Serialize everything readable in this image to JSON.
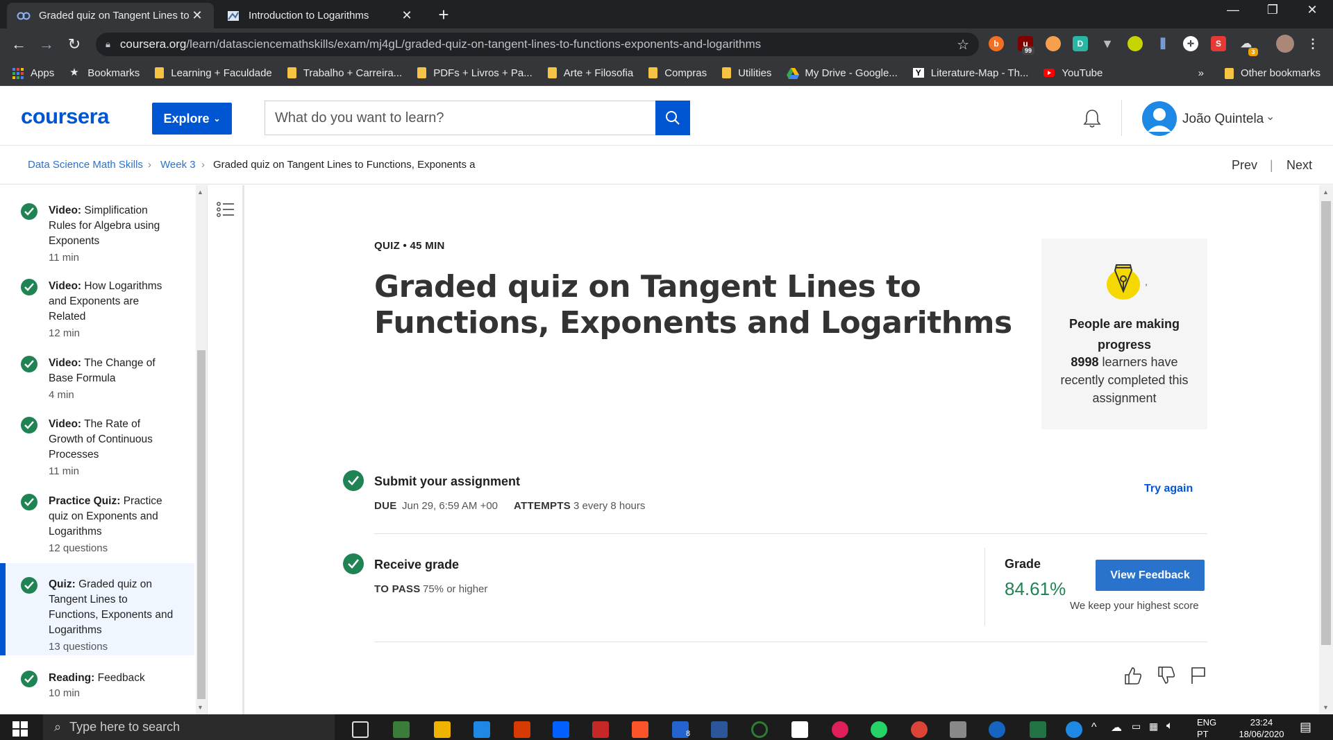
{
  "browser": {
    "tabs": [
      {
        "title": "Graded quiz on Tangent Lines to",
        "active": true
      },
      {
        "title": "Introduction to Logarithms",
        "active": false
      }
    ],
    "url_host": "coursera.org",
    "url_path": "/learn/datasciencemathskills/exam/mj4gL/graded-quiz-on-tangent-lines-to-functions-exponents-and-logarithms",
    "extension_badges": {
      "ublock": "99",
      "other": "3"
    },
    "bookmarks": [
      {
        "label": "Apps",
        "icon": "apps-grid-icon"
      },
      {
        "label": "Bookmarks",
        "icon": "star-icon"
      },
      {
        "label": "Learning + Faculdade",
        "icon": "folder-icon"
      },
      {
        "label": "Trabalho + Carreira...",
        "icon": "folder-icon"
      },
      {
        "label": "PDFs + Livros + Pa...",
        "icon": "folder-icon"
      },
      {
        "label": "Arte + Filosofia",
        "icon": "folder-icon"
      },
      {
        "label": "Compras",
        "icon": "folder-icon"
      },
      {
        "label": "Utilities",
        "icon": "folder-icon"
      },
      {
        "label": "My Drive - Google...",
        "icon": "google-drive-icon"
      },
      {
        "label": "Literature-Map - Th...",
        "icon": "literature-map-icon"
      },
      {
        "label": "YouTube",
        "icon": "youtube-icon"
      }
    ],
    "bookmarks_overflow": "»",
    "other_bookmarks": "Other bookmarks"
  },
  "header": {
    "logo": "coursera",
    "explore_label": "Explore",
    "search_placeholder": "What do you want to learn?",
    "user_name": "João Quintela"
  },
  "breadcrumb": {
    "course": "Data Science Math Skills",
    "week": "Week 3",
    "current": "Graded quiz on Tangent Lines to Functions, Exponents a",
    "prev": "Prev",
    "next": "Next",
    "sep": "|"
  },
  "sidebar": {
    "items": [
      {
        "kind": "Video:",
        "title": "Simplification Rules for Algebra using Exponents",
        "meta": "11 min",
        "completed": true,
        "active": false
      },
      {
        "kind": "Video:",
        "title": "How Logarithms and Exponents are Related",
        "meta": "12 min",
        "completed": true,
        "active": false
      },
      {
        "kind": "Video:",
        "title": "The Change of Base Formula",
        "meta": "4 min",
        "completed": true,
        "active": false
      },
      {
        "kind": "Video:",
        "title": "The Rate of Growth of Continuous Processes",
        "meta": "11 min",
        "completed": true,
        "active": false
      },
      {
        "kind": "Practice Quiz:",
        "title": "Practice quiz on Exponents and Logarithms",
        "meta": "12 questions",
        "completed": true,
        "active": true
      },
      {
        "kind": "Quiz:",
        "title": "Graded quiz on Tangent Lines to Functions, Exponents and Logarithms",
        "meta": "13 questions",
        "completed": true,
        "active": true
      },
      {
        "kind": "Reading:",
        "title": "Feedback",
        "meta": "10 min",
        "completed": true,
        "active": false
      }
    ]
  },
  "quiz": {
    "meta": "QUIZ • 45 MIN",
    "title": "Graded quiz on Tangent Lines to Functions, Exponents and Logarithms"
  },
  "progress_card": {
    "heading": "People are making progress",
    "count": "8998",
    "text": "learners have recently completed this assignment",
    "comma": ","
  },
  "submit": {
    "title": "Submit your assignment",
    "due_label": "DUE",
    "due_value": "Jun 29, 6:59 AM +00",
    "attempts_label": "ATTEMPTS",
    "attempts_value": "3 every 8 hours",
    "try_again": "Try again"
  },
  "receive": {
    "title": "Receive grade",
    "pass_label": "TO PASS",
    "pass_value": "75% or higher",
    "grade_label": "Grade",
    "grade_value": "84.61%",
    "view_feedback": "View Feedback",
    "keep_note": "We keep your highest score"
  },
  "taskbar": {
    "search_placeholder": "Type here to search",
    "lang1": "ENG",
    "lang2": "PT",
    "time": "23:24",
    "date": "18/06/2020",
    "todo_badge": "8"
  },
  "colors": {
    "brand": "#0056d2",
    "success": "#1f8354",
    "link": "#2a73cc"
  }
}
